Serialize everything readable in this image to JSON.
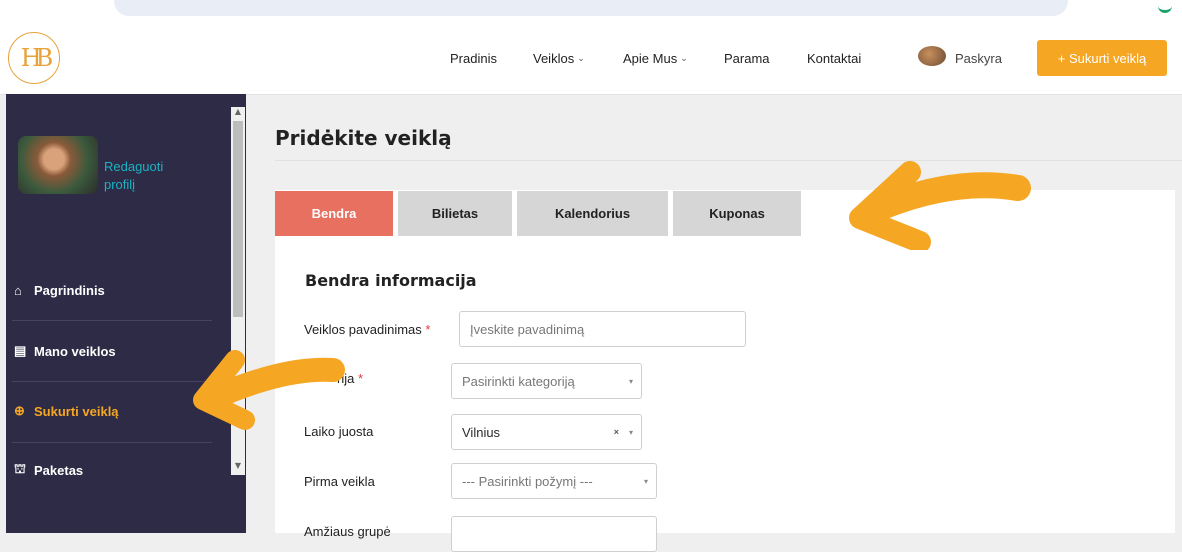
{
  "nav": {
    "items": [
      {
        "label": "Pradinis",
        "has_caret": false
      },
      {
        "label": "Veiklos",
        "has_caret": true
      },
      {
        "label": "Apie Mus",
        "has_caret": true
      },
      {
        "label": "Parama",
        "has_caret": false
      },
      {
        "label": "Kontaktai",
        "has_caret": false
      }
    ],
    "caret": "⌄",
    "account_label": "Paskyra",
    "create_button": "+ Sukurti veiklą"
  },
  "logo": {
    "text": "HB",
    "color": "#e8a23a"
  },
  "sidebar": {
    "edit_profile": "Redaguoti profilį",
    "items": [
      {
        "label": "Pagrindinis",
        "icon": "home-icon",
        "glyph": "⌂",
        "color": "#ffffff"
      },
      {
        "label": "Mano veiklos",
        "icon": "document-icon",
        "glyph": "▤",
        "color": "#ffffff"
      },
      {
        "label": "Sukurti veiklą",
        "icon": "plus-circle-icon",
        "glyph": "⊕",
        "color": "#f5a623"
      },
      {
        "label": "Paketas",
        "icon": "gift-icon",
        "glyph": "⛫",
        "color": "#ffffff"
      }
    ]
  },
  "page": {
    "title": "Pridėkite veiklą"
  },
  "tabs": [
    {
      "label": "Bendra",
      "active": true
    },
    {
      "label": "Bilietas",
      "active": false
    },
    {
      "label": "Kalendorius",
      "active": false
    },
    {
      "label": "Kuponas",
      "active": false
    }
  ],
  "form": {
    "section_title": "Bendra informacija",
    "required_mark": "*",
    "name_label": "Veiklos pavadinimas",
    "name_placeholder": "Įveskite pavadinimą",
    "category_label_visible": "rija",
    "category_placeholder": "Pasirinkti kategoriją",
    "timezone_label": "Laiko juosta",
    "timezone_value": "Vilnius",
    "first_label": "Pirma veikla",
    "first_placeholder": "--- Pasirinkti požymį ---",
    "next_label_partial": "Amžiaus grupė",
    "clear_glyph": "×",
    "caret_glyph": "▾"
  },
  "colors": {
    "accent": "#f5a623",
    "tab_active": "#e87060",
    "sidebar_bg": "#2d2b45",
    "link": "#1ab3c4"
  }
}
